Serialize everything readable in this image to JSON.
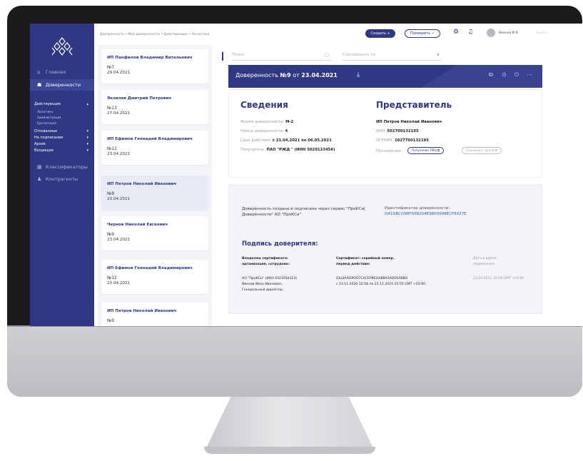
{
  "breadcrumb": "Доверенности • Мои доверенности • Действующие • Логистика",
  "topbar": {
    "create_label": "Создать +",
    "check_label": "Проверить ✓",
    "user_name": "Иванов И.И.",
    "extra": "Выйти"
  },
  "sidebar": {
    "items": [
      {
        "label": "Главная",
        "icon": "home-icon"
      },
      {
        "label": "Доверенности",
        "icon": "users-icon"
      }
    ],
    "sections": {
      "active": "Действующие",
      "sub": [
        "Логистика",
        "Администрация",
        "Бухгалтерия"
      ],
      "others": [
        "Отозванные",
        "На подписании",
        "Архив",
        "Входящие"
      ]
    },
    "bottom": [
      {
        "label": "Классификаторы",
        "icon": "grid-icon"
      },
      {
        "label": "Контрагенты",
        "icon": "person-icon"
      }
    ]
  },
  "list": {
    "cards": [
      {
        "name": "ИП Панфилов Владимир Витальевич",
        "number": "№7",
        "date": "29.04.2021"
      },
      {
        "name": "Яковлев Дмитрий Петрович",
        "number": "№13",
        "date": "27.04.2021"
      },
      {
        "name": "ИП Ефимов Геннадий Владимирович",
        "number": "№12",
        "date": "23.04.2021"
      },
      {
        "name": "ИП Петров Николай Иванович",
        "number": "№9",
        "date": "23.04.2021"
      },
      {
        "name": "Чернов Николай Евсеевич",
        "number": "№9",
        "date": "23.04.2021"
      },
      {
        "name": "ИП Ефимов Геннадий Владимирович",
        "number": "№12",
        "date": "23.04.2021"
      },
      {
        "name": "ИП Петров Николай Иванович",
        "number": "№9",
        "date": ""
      }
    ]
  },
  "search": {
    "placeholder": "Поиск",
    "sort_placeholder": "Сортировать по"
  },
  "document": {
    "title_prefix": "Доверенность ",
    "title_number": "№9",
    "title_mid": " от ",
    "title_date": "23.04.2021"
  },
  "info": {
    "left_title": "Сведения",
    "right_title": "Представитель",
    "form_label": "Форма доверенности: ",
    "form_value": "М-2",
    "number_label": "Номер доверенности: ",
    "number_value": "4",
    "term_label": "Срок действия: ",
    "term_value": "с 23.04.2021 по 06.05.2021",
    "recipient_label": "Получатель: ",
    "recipient_value": "ПАО \"РЖД \" (ИНН 5029123456)",
    "rep_name": "ИП Петров Николай Иванович",
    "inn_label": "ИНН: ",
    "inn_value": "502700132195",
    "ogrnip_label": "ОГРНИП: ",
    "ogrnip_value": "1027700132195",
    "powers_label": "Полномочия:",
    "powers": [
      "Получение ТМЦ",
      "Перевозка грузов"
    ]
  },
  "signature": {
    "created_text": "Доверенность создана и подписана через сервис \"ПроКСи|Доверенности\" АО \"ПроКСи\"",
    "id_label": "Идентификатор доверенности:",
    "id_value": "D41DBCD98F00B204E9800998ECF8427E",
    "title": "Подпись доверителя:",
    "col1_head_1": "Владелец сертификата:",
    "col1_head_2": "организация, сотрудник:",
    "col1_v1": "АО \"ПроКСи\" (ИНН 4321654323)",
    "col1_v2": "Иванов Иван Иванович,",
    "col1_v3": "Генеральный директор",
    "col2_head_1": "Сертификат: серийный номер,",
    "col2_head_2": "период действия:",
    "col2_v1": "03а3AAOPOO7CACEPBEOABBA3AOE6ABBO",
    "col2_v2": "с 23.11.2020 15:58 по 23.11.2021 15:55 GMT +03:00",
    "col3_head_1": "Дата и время",
    "col3_head_2": "подписания:",
    "col3_v1": "23.04.2021 16:58 GMT +03:00"
  },
  "colors": {
    "brand": "#2f3883",
    "accent_link": "#3a52c8"
  }
}
